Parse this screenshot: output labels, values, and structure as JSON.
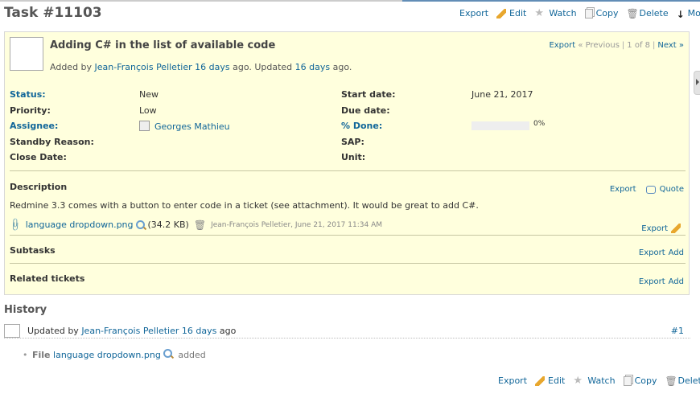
{
  "header": {
    "title": "Task #11103"
  },
  "toolbar_top": {
    "export": "Export",
    "edit": "Edit",
    "watch": "Watch",
    "copy": "Copy",
    "delete": "Delete",
    "more": "More"
  },
  "issue": {
    "subject": "Adding C# in the list of available code",
    "added_by_prefix": "Added by ",
    "author": "Jean-François Pelletier",
    "created_ago": "16 days",
    "ago_updated": " ago. Updated ",
    "updated_ago": "16 days",
    "ago_end": " ago.",
    "nav": {
      "export": "Export",
      "previous": "« Previous",
      "position": "1 of 8",
      "next": "Next »"
    }
  },
  "attributes": {
    "status_label": "Status:",
    "status_value": "New",
    "priority_label": "Priority:",
    "priority_value": "Low",
    "assignee_label": "Assignee:",
    "assignee_value": "Georges Mathieu",
    "standby_label": "Standby Reason:",
    "close_label": "Close Date:",
    "start_label": "Start date:",
    "start_value": "June 21, 2017",
    "due_label": "Due date:",
    "done_label": "% Done:",
    "done_value": "0%",
    "done_fraction": 0,
    "sap_label": "SAP:",
    "unit_label": "Unit:"
  },
  "description": {
    "heading": "Description",
    "text": "Redmine 3.3 comes with a button to enter code in a ticket (see attachment). It would be great to add C#.",
    "export": "Export",
    "quote": "Quote"
  },
  "attachment": {
    "filename": "language dropdown.png",
    "size": "(34.2 KB)",
    "meta": "Jean-François Pelletier, June 21, 2017 11:34 AM",
    "export": "Export"
  },
  "subtasks": {
    "heading": "Subtasks",
    "export": "Export",
    "add": "Add"
  },
  "related": {
    "heading": "Related tickets",
    "export": "Export",
    "add": "Add"
  },
  "history": {
    "heading": "History",
    "journal": {
      "prefix": "Updated by ",
      "author": "Jean-François Pelletier",
      "ago": "16 days",
      "ago_end": " ago",
      "number": "#1",
      "item_label": "File",
      "item_file": "language dropdown.png",
      "item_action": "added"
    }
  },
  "toolbar_bottom": {
    "export": "Export",
    "edit": "Edit",
    "watch": "Watch",
    "copy": "Copy",
    "delete": "Delete"
  },
  "colors": {
    "link": "#116699",
    "issue_bg": "#ffffdd",
    "header_accent": "#628db6"
  },
  "icons": [
    "pencil-icon",
    "star-icon",
    "copy-icon",
    "trash-icon",
    "arrow-down-icon",
    "paperclip-icon",
    "magnifier-icon",
    "quote-icon",
    "user-icon"
  ]
}
